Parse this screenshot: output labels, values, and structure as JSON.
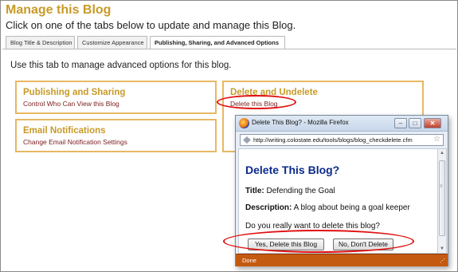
{
  "page": {
    "title": "Manage this Blog",
    "intro": "Click on one of the tabs below to update and manage this Blog."
  },
  "tabs": [
    {
      "label": "Blog Title & Description",
      "active": false
    },
    {
      "label": "Customize Appearance",
      "active": false
    },
    {
      "label": "Publishing, Sharing, and Advanced Options",
      "active": true
    }
  ],
  "panel": {
    "intro": "Use this tab to manage advanced options for this blog.",
    "options": {
      "publishing": {
        "title": "Publishing and Sharing",
        "link": "Control Who Can View this Blog"
      },
      "email": {
        "title": "Email Notifications",
        "link": "Change Email Notification Settings"
      },
      "delete": {
        "title": "Delete and Undelete",
        "link": "Delete this Blog"
      }
    }
  },
  "popup": {
    "window_title": "Delete This Blog? - Mozilla Firefox",
    "url": "http://writing.colostate.edu/tools/blogs/blog_checkdelete.cfm",
    "heading": "Delete This Blog?",
    "title_label": "Title:",
    "title_value": " Defending the Goal",
    "description_label": "Description:",
    "description_value": " A blog about being a goal keeper",
    "question": "Do you really want to delete this blog?",
    "yes_button": "Yes, Delete this Blog",
    "no_button": "No, Don't Delete",
    "status": "Done"
  },
  "colors": {
    "heading_gold": "#c89a28",
    "box_border": "#e7b864",
    "link_maroon": "#7a1c1c",
    "highlight_red": "#e01010",
    "popup_heading": "#0b2a8a",
    "statusbar": "#c45a10"
  },
  "icons": {
    "browser": "firefox-icon",
    "addr": "site-identity-icon",
    "bookmark": "star-icon"
  }
}
